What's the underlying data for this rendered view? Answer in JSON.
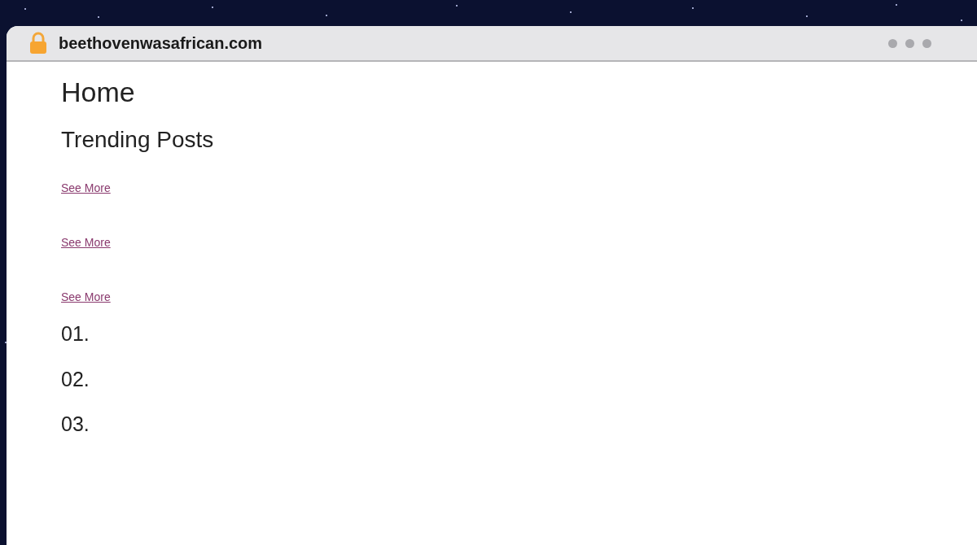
{
  "address_bar": {
    "url": "beethovenwasafrican.com"
  },
  "page": {
    "title": "Home",
    "section_title": "Trending Posts",
    "links": [
      "See More",
      "See More",
      "See More"
    ],
    "list_numbers": [
      "01.",
      "02.",
      "03."
    ]
  }
}
